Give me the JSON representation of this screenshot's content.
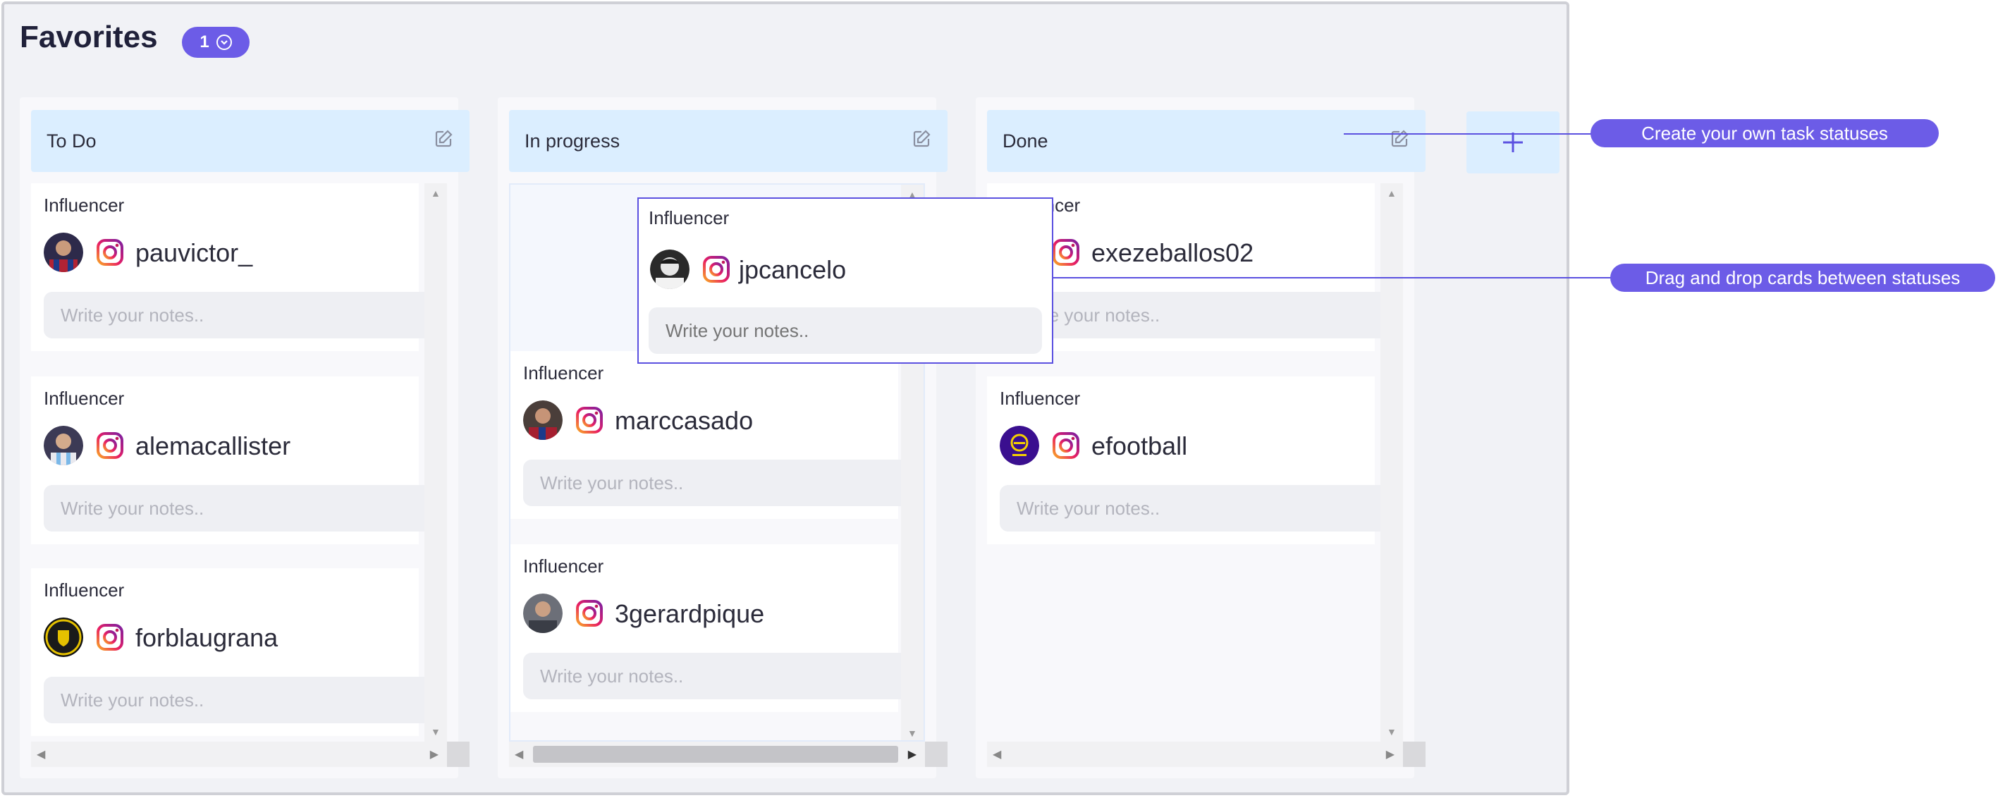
{
  "page": {
    "title": "Favorites",
    "favorites_count": "1"
  },
  "columns": [
    {
      "title": "To Do",
      "cards": [
        {
          "type": "Influencer",
          "handle": "pauvictor_",
          "placeholder": "Write your notes.."
        },
        {
          "type": "Influencer",
          "handle": "alemacallister",
          "placeholder": "Write your notes.."
        },
        {
          "type": "Influencer",
          "handle": "forblaugrana",
          "placeholder": "Write your notes.."
        }
      ]
    },
    {
      "title": "In progress",
      "cards": [
        {
          "type": "Influencer",
          "handle": "marccasado",
          "placeholder": "Write your notes.."
        },
        {
          "type": "Influencer",
          "handle": "3gerardpique",
          "placeholder": "Write your notes.."
        }
      ]
    },
    {
      "title": "Done",
      "cards": [
        {
          "type": "Influencer",
          "handle": "exezeballos02",
          "placeholder": "Write your notes.."
        },
        {
          "type": "Influencer",
          "handle": "efootball",
          "placeholder": "Write your notes.."
        }
      ]
    }
  ],
  "dragging_card": {
    "type": "Influencer",
    "handle": "jpcancelo",
    "placeholder": "Write your notes.."
  },
  "callouts": {
    "statuses": "Create your own task statuses",
    "drag": "Drag and drop cards between statuses"
  },
  "icons": {
    "edit": "edit-icon",
    "instagram": "instagram-icon",
    "add": "plus-icon"
  },
  "colors": {
    "accent": "#6c5ce7",
    "header_bg": "#dbeeff"
  }
}
